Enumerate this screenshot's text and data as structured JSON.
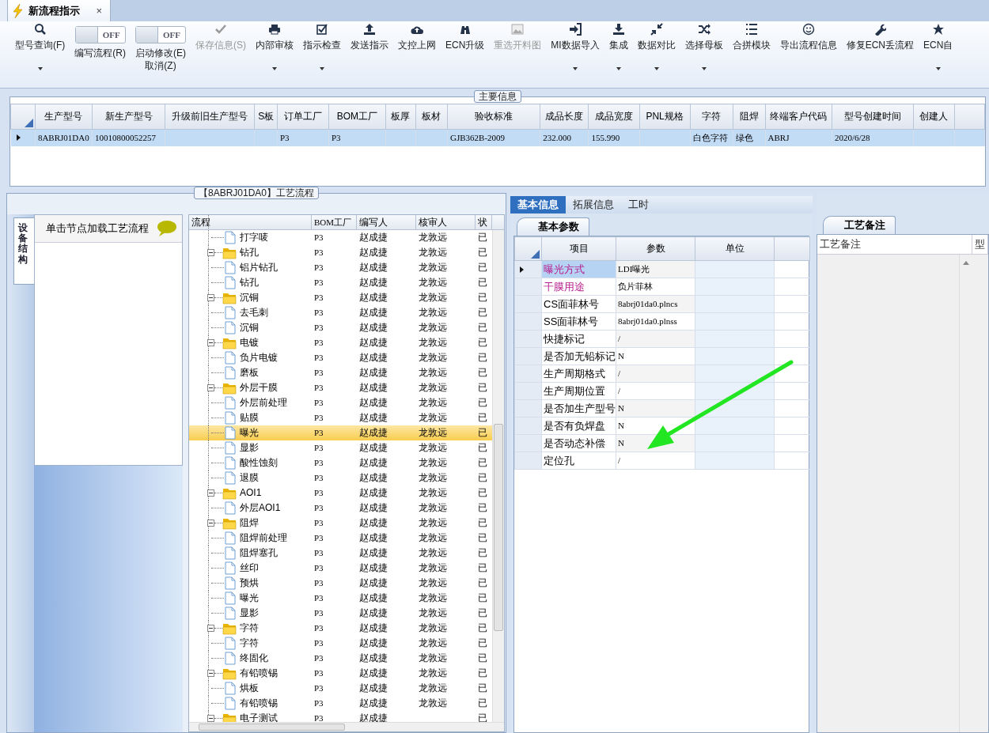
{
  "document_tab": {
    "title": "新流程指示",
    "close": "×"
  },
  "toolbar": [
    {
      "kind": "button",
      "label": "型号查询(F)",
      "caret": true,
      "disabled": false
    },
    {
      "kind": "toggle",
      "toggle_text": "OFF",
      "on": false,
      "label": "编写流程(R)"
    },
    {
      "kind": "toggle",
      "toggle_text": "OFF",
      "on": false,
      "label": "启动修改(E)",
      "label2": "取消(Z)"
    },
    {
      "kind": "button",
      "label": "保存信息(S)",
      "caret": false,
      "disabled": true
    },
    {
      "kind": "button",
      "label": "内部审核",
      "caret": true,
      "disabled": false
    },
    {
      "kind": "button",
      "label": "指示检查",
      "caret": true,
      "disabled": false
    },
    {
      "kind": "button",
      "label": "发送指示",
      "caret": false,
      "disabled": false
    },
    {
      "kind": "button",
      "label": "文控上网",
      "caret": false,
      "disabled": false
    },
    {
      "kind": "button",
      "label": "ECN升级",
      "caret": false,
      "disabled": false
    },
    {
      "kind": "button",
      "label": "重选开料图",
      "caret": false,
      "disabled": true
    },
    {
      "kind": "button",
      "label": "MI数据导入",
      "caret": true,
      "disabled": false
    },
    {
      "kind": "button",
      "label": "集成",
      "caret": true,
      "disabled": false
    },
    {
      "kind": "button",
      "label": "数据对比",
      "caret": true,
      "disabled": false
    },
    {
      "kind": "button",
      "label": "选择母板",
      "caret": true,
      "disabled": false
    },
    {
      "kind": "button",
      "label": "合拼模块",
      "caret": false,
      "disabled": false
    },
    {
      "kind": "button",
      "label": "导出流程信息",
      "caret": false,
      "disabled": false
    },
    {
      "kind": "button",
      "label": "修复ECN丢流程",
      "caret": false,
      "disabled": false
    },
    {
      "kind": "button",
      "label": "ECN自",
      "caret": true,
      "disabled": false
    }
  ],
  "main_info": {
    "title": "主要信息",
    "columns": [
      "生产型号",
      "新生产型号",
      "升级前旧生产型号",
      "S板",
      "订单工厂",
      "BOM工厂",
      "板厚",
      "板材",
      "验收标准",
      "成品长度",
      "成品宽度",
      "PNL规格",
      "字符",
      "阻焊",
      "终端客户代码",
      "型号创建时间",
      "创建人"
    ],
    "rows": [
      {
        "selected": true,
        "cells": [
          "8ABRJ01DA0",
          "10010800052257",
          null,
          null,
          "P3",
          "P3",
          null,
          null,
          "GJB362B-2009",
          "232.000",
          "155.990",
          null,
          "白色字符",
          "绿色",
          "ABRJ",
          "2020/6/28",
          null
        ]
      }
    ]
  },
  "process_panel": {
    "title": "【8ABRJ01DA0】工艺流程",
    "side_tab": "设备结构",
    "hint": "单击节点加载工艺流程",
    "columns": [
      "流程",
      "BOM工厂",
      "编写人",
      "核审人",
      "状"
    ],
    "tree": [
      {
        "label": "打字唛",
        "bom": "P3",
        "author": "赵成捷",
        "reviewer": "龙敦远",
        "status": "已",
        "selected": false
      },
      {
        "label": "钻孔",
        "bom": "P3",
        "author": "赵成捷",
        "reviewer": "龙敦远",
        "status": "已",
        "selected": false,
        "expanded": true,
        "children": [
          {
            "label": "铝片钻孔",
            "bom": "P3",
            "author": "赵成捷",
            "reviewer": "龙敦远",
            "status": "已",
            "selected": false
          },
          {
            "label": "钻孔",
            "bom": "P3",
            "author": "赵成捷",
            "reviewer": "龙敦远",
            "status": "已",
            "selected": false
          }
        ]
      },
      {
        "label": "沉铜",
        "bom": "P3",
        "author": "赵成捷",
        "reviewer": "龙敦远",
        "status": "已",
        "selected": false,
        "expanded": true,
        "children": [
          {
            "label": "去毛刺",
            "bom": "P3",
            "author": "赵成捷",
            "reviewer": "龙敦远",
            "status": "已",
            "selected": false
          },
          {
            "label": "沉铜",
            "bom": "P3",
            "author": "赵成捷",
            "reviewer": "龙敦远",
            "status": "已",
            "selected": false
          }
        ]
      },
      {
        "label": "电镀",
        "bom": "P3",
        "author": "赵成捷",
        "reviewer": "龙敦远",
        "status": "已",
        "selected": false,
        "expanded": true,
        "children": [
          {
            "label": "负片电镀",
            "bom": "P3",
            "author": "赵成捷",
            "reviewer": "龙敦远",
            "status": "已",
            "selected": false
          },
          {
            "label": "磨板",
            "bom": "P3",
            "author": "赵成捷",
            "reviewer": "龙敦远",
            "status": "已",
            "selected": false
          }
        ]
      },
      {
        "label": "外层干膜",
        "bom": "P3",
        "author": "赵成捷",
        "reviewer": "龙敦远",
        "status": "已",
        "selected": false,
        "expanded": true,
        "children": [
          {
            "label": "外层前处理",
            "bom": "P3",
            "author": "赵成捷",
            "reviewer": "龙敦远",
            "status": "已",
            "selected": false
          },
          {
            "label": "贴膜",
            "bom": "P3",
            "author": "赵成捷",
            "reviewer": "龙敦远",
            "status": "已",
            "selected": false
          },
          {
            "label": "曝光",
            "bom": "P3",
            "author": "赵成捷",
            "reviewer": "龙敦远",
            "status": "已",
            "selected": true
          },
          {
            "label": "显影",
            "bom": "P3",
            "author": "赵成捷",
            "reviewer": "龙敦远",
            "status": "已",
            "selected": false
          },
          {
            "label": "酸性蚀刻",
            "bom": "P3",
            "author": "赵成捷",
            "reviewer": "龙敦远",
            "status": "已",
            "selected": false
          },
          {
            "label": "退膜",
            "bom": "P3",
            "author": "赵成捷",
            "reviewer": "龙敦远",
            "status": "已",
            "selected": false
          }
        ]
      },
      {
        "label": "AOI1",
        "bom": "P3",
        "author": "赵成捷",
        "reviewer": "龙敦远",
        "status": "已",
        "selected": false,
        "expanded": true,
        "children": [
          {
            "label": "外层AOI1",
            "bom": "P3",
            "author": "赵成捷",
            "reviewer": "龙敦远",
            "status": "已",
            "selected": false
          }
        ]
      },
      {
        "label": "阻焊",
        "bom": "P3",
        "author": "赵成捷",
        "reviewer": "龙敦远",
        "status": "已",
        "selected": false,
        "expanded": true,
        "children": [
          {
            "label": "阻焊前处理",
            "bom": "P3",
            "author": "赵成捷",
            "reviewer": "龙敦远",
            "status": "已",
            "selected": false
          },
          {
            "label": "阻焊塞孔",
            "bom": "P3",
            "author": "赵成捷",
            "reviewer": "龙敦远",
            "status": "已",
            "selected": false
          },
          {
            "label": "丝印",
            "bom": "P3",
            "author": "赵成捷",
            "reviewer": "龙敦远",
            "status": "已",
            "selected": false
          },
          {
            "label": "预烘",
            "bom": "P3",
            "author": "赵成捷",
            "reviewer": "龙敦远",
            "status": "已",
            "selected": false
          },
          {
            "label": "曝光",
            "bom": "P3",
            "author": "赵成捷",
            "reviewer": "龙敦远",
            "status": "已",
            "selected": false
          },
          {
            "label": "显影",
            "bom": "P3",
            "author": "赵成捷",
            "reviewer": "龙敦远",
            "status": "已",
            "selected": false
          }
        ]
      },
      {
        "label": "字符",
        "bom": "P3",
        "author": "赵成捷",
        "reviewer": "龙敦远",
        "status": "已",
        "selected": false,
        "expanded": true,
        "children": [
          {
            "label": "字符",
            "bom": "P3",
            "author": "赵成捷",
            "reviewer": "龙敦远",
            "status": "已",
            "selected": false
          },
          {
            "label": "终固化",
            "bom": "P3",
            "author": "赵成捷",
            "reviewer": "龙敦远",
            "status": "已",
            "selected": false
          }
        ]
      },
      {
        "label": "有铅喷锡",
        "bom": "P3",
        "author": "赵成捷",
        "reviewer": "龙敦远",
        "status": "已",
        "selected": false,
        "expanded": true,
        "children": [
          {
            "label": "烘板",
            "bom": "P3",
            "author": "赵成捷",
            "reviewer": "龙敦远",
            "status": "已",
            "selected": false
          },
          {
            "label": "有铅喷锡",
            "bom": "P3",
            "author": "赵成捷",
            "reviewer": "龙敦远",
            "status": "已",
            "selected": false
          }
        ]
      },
      {
        "label": "电子测试",
        "bom": "P3",
        "author": "赵成捷",
        "status": "已",
        "selected": false,
        "expanded": true
      }
    ]
  },
  "detail_tabs": [
    {
      "label": "基本信息",
      "selected": true
    },
    {
      "label": "拓展信息",
      "selected": false
    },
    {
      "label": "工时",
      "selected": false
    }
  ],
  "params": {
    "tab": "基本参数",
    "columns": [
      "项目",
      "参数",
      "单位"
    ],
    "rows": [
      {
        "item": "曝光方式",
        "value": "LDI曝光",
        "color": "#b5208f",
        "selected": true
      },
      {
        "item": "干膜用途",
        "value": "负片菲林",
        "color": "#b5208f",
        "selected": false
      },
      {
        "item": "CS面菲林号",
        "value": "8abrj01da0.plncs",
        "selected": false
      },
      {
        "item": "SS面菲林号",
        "value": "8abrj01da0.plnss",
        "selected": false
      },
      {
        "item": "快捷标记",
        "value": "/",
        "selected": false
      },
      {
        "item": "是否加无铅标记",
        "value": "N",
        "selected": false
      },
      {
        "item": "生产周期格式",
        "value": "/",
        "selected": false
      },
      {
        "item": "生产周期位置",
        "value": "/",
        "selected": false
      },
      {
        "item": "是否加生产型号",
        "value": "N",
        "selected": false
      },
      {
        "item": "是否有负焊盘",
        "value": "N",
        "selected": false
      },
      {
        "item": "是否动态补偿",
        "value": "N",
        "selected": false
      },
      {
        "item": "定位孔",
        "value": "/",
        "selected": false
      }
    ]
  },
  "notes_panel": {
    "tab": "工艺备注",
    "columns": [
      "工艺备注",
      "型"
    ]
  }
}
